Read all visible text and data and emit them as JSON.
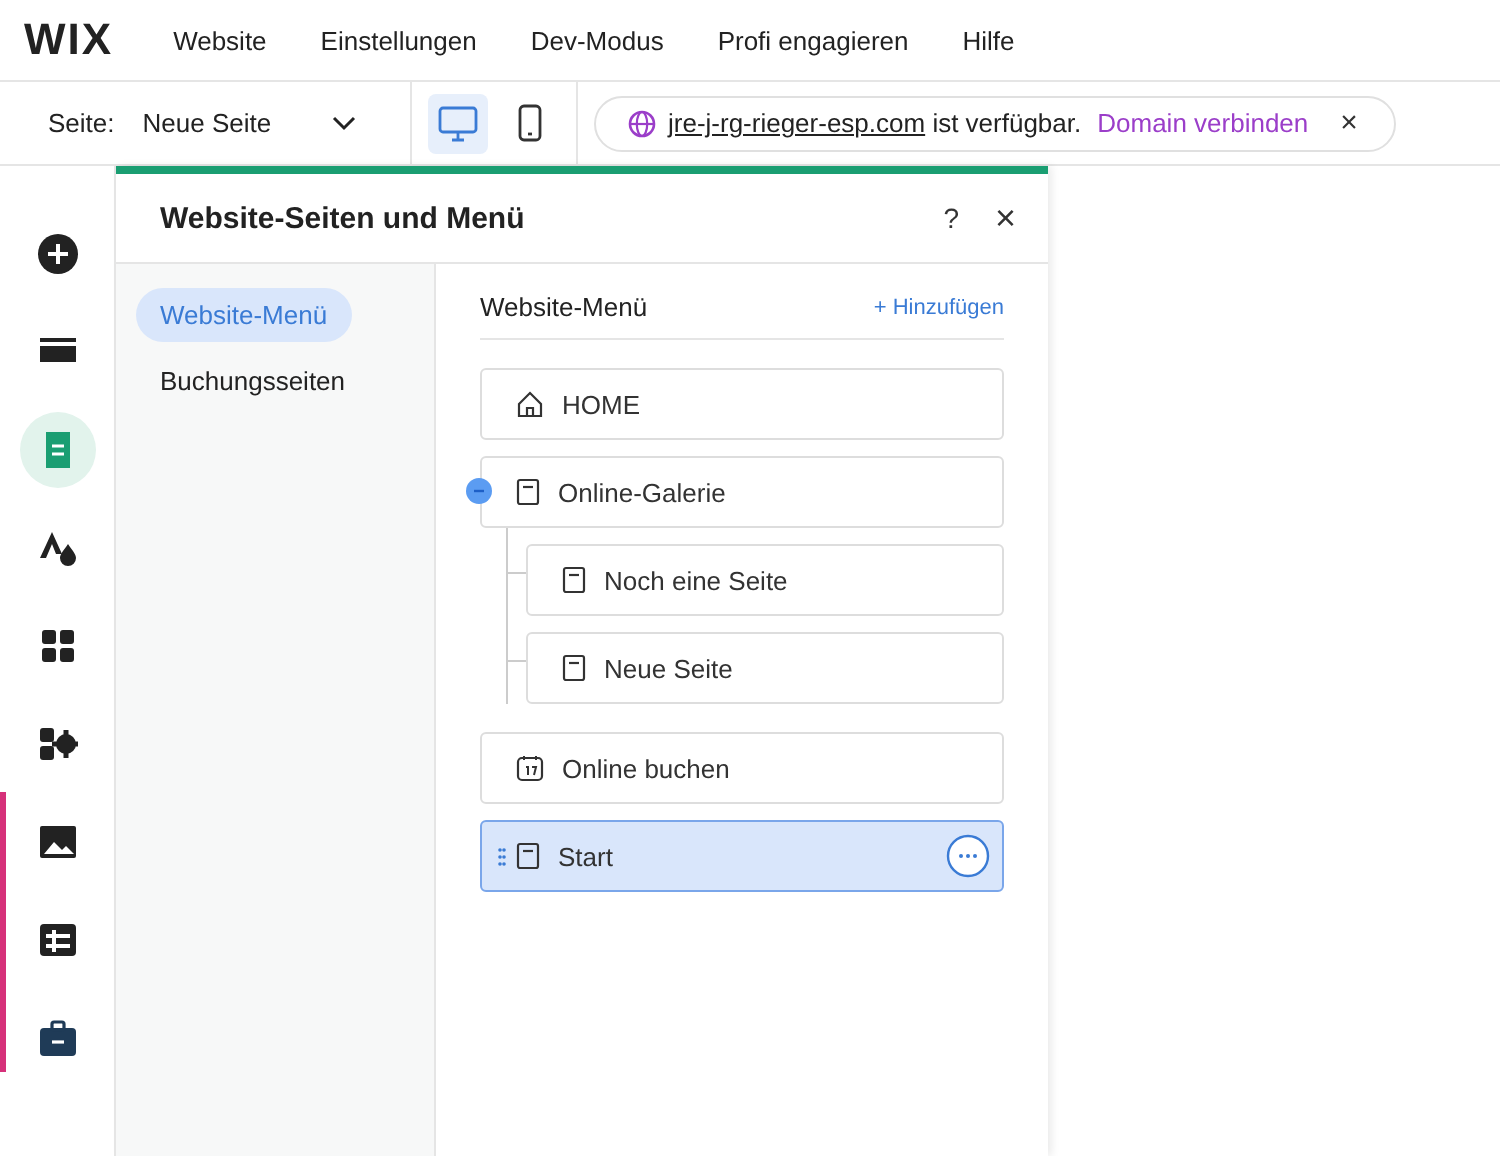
{
  "top_menu": {
    "logo": "WIX",
    "items": [
      "Website",
      "Einstellungen",
      "Dev-Modus",
      "Profi engagieren",
      "Hilfe"
    ]
  },
  "toolbar": {
    "page_label": "Seite:",
    "page_value": "Neue Seite",
    "devices": [
      {
        "kind": "desktop",
        "selected": true
      },
      {
        "kind": "mobile",
        "selected": false
      }
    ],
    "domain_notice": {
      "domain": "jre-j-rg-rieger-esp.com",
      "text": "ist verfügbar.",
      "link": "Domain verbinden",
      "close": "×"
    }
  },
  "rail": [
    {
      "kind": "add",
      "selected": false
    },
    {
      "kind": "sections",
      "selected": false
    },
    {
      "kind": "pages",
      "selected": true
    },
    {
      "kind": "design",
      "selected": false
    },
    {
      "kind": "apps",
      "selected": false
    },
    {
      "kind": "business",
      "selected": false
    },
    {
      "kind": "media",
      "selected": false
    },
    {
      "kind": "cms",
      "selected": false
    },
    {
      "kind": "portfolio",
      "selected": false
    }
  ],
  "panel": {
    "title": "Website-Seiten und Menü",
    "help": "?",
    "close": "×",
    "nav": [
      {
        "label": "Website-Menü",
        "selected": true
      },
      {
        "label": "Buchungsseiten",
        "selected": false
      }
    ],
    "menu_title": "Website-Menü",
    "add_link": "+ Hinzufügen",
    "pages": [
      {
        "label": "HOME",
        "kind": "home",
        "selected": false
      },
      {
        "label": "Online-Galerie",
        "kind": "page",
        "selected": false,
        "expanded": true,
        "children": [
          {
            "label": "Noch eine Seite",
            "kind": "page",
            "selected": false
          },
          {
            "label": "Neue Seite",
            "kind": "page",
            "selected": false
          }
        ]
      },
      {
        "label": "Online buchen",
        "kind": "calendar",
        "selected": false
      },
      {
        "label": "Start",
        "kind": "page",
        "selected": true
      }
    ]
  }
}
